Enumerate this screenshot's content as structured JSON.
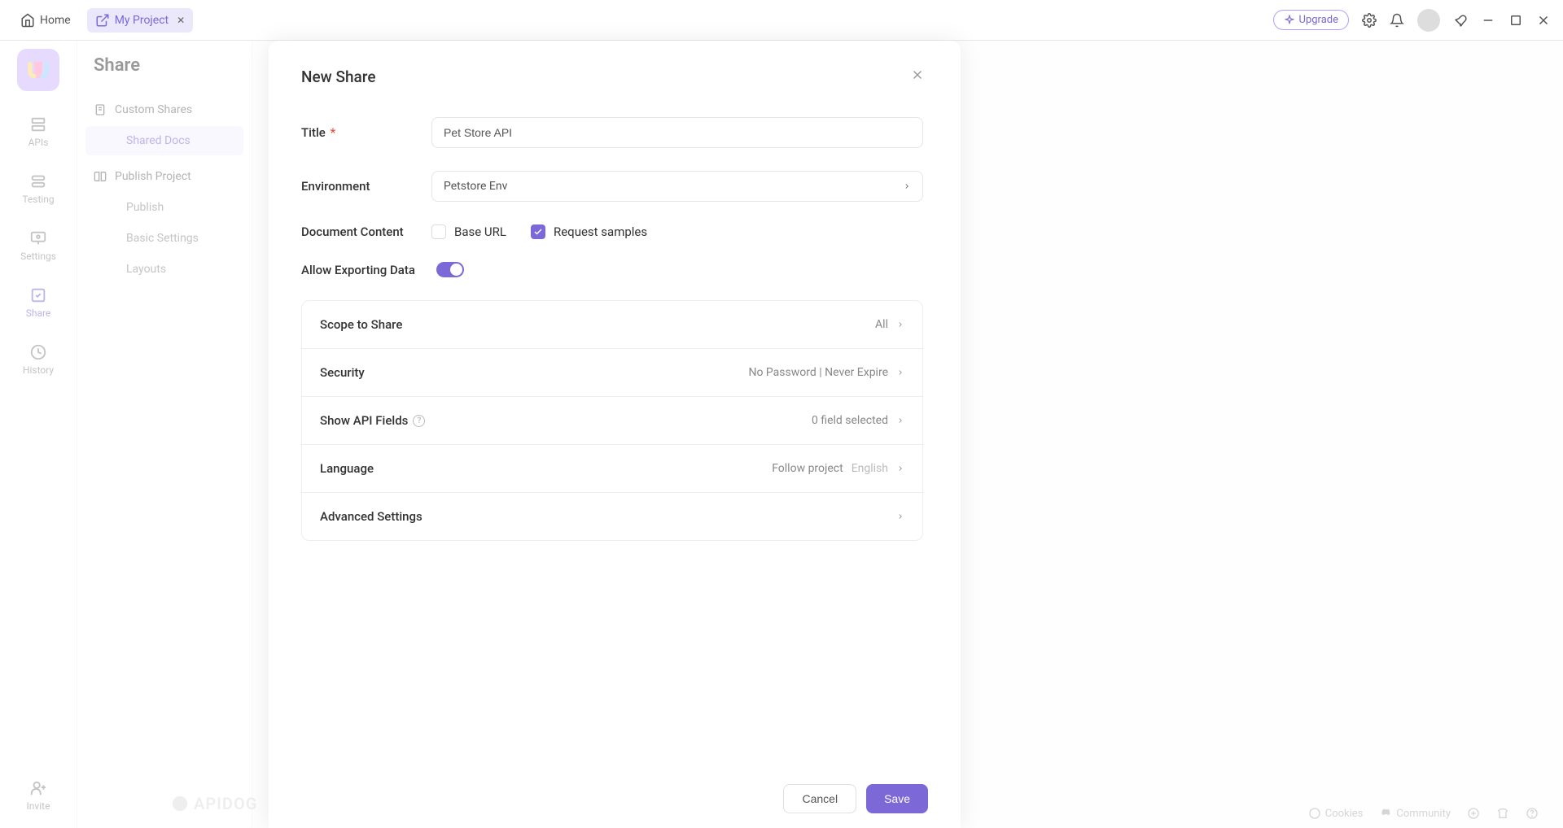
{
  "topbar": {
    "home_label": "Home",
    "tab_label": "My Project",
    "upgrade_label": "Upgrade"
  },
  "rail": {
    "apis": "APIs",
    "testing": "Testing",
    "settings": "Settings",
    "share": "Share",
    "history": "History",
    "invite": "Invite"
  },
  "sidebar": {
    "title": "Share",
    "custom_shares": "Custom Shares",
    "shared_docs": "Shared Docs",
    "publish_project": "Publish Project",
    "publish": "Publish",
    "basic_settings": "Basic Settings",
    "layouts": "Layouts"
  },
  "bottombar": {
    "cookies": "Cookies",
    "community": "Community"
  },
  "watermark": "APIDOG",
  "modal": {
    "title": "New Share",
    "fields": {
      "title_label": "Title",
      "title_value": "Pet Store API",
      "env_label": "Environment",
      "env_value": "Petstore Env",
      "doc_content_label": "Document Content",
      "base_url_label": "Base URL",
      "request_samples_label": "Request samples",
      "allow_export_label": "Allow Exporting Data"
    },
    "settings": {
      "scope_label": "Scope to Share",
      "scope_value": "All",
      "security_label": "Security",
      "security_value": "No Password | Never Expire",
      "api_fields_label": "Show API Fields",
      "api_fields_value": "0 field selected",
      "language_label": "Language",
      "language_value1": "Follow project",
      "language_value2": "English",
      "advanced_label": "Advanced Settings"
    },
    "cancel": "Cancel",
    "save": "Save"
  }
}
